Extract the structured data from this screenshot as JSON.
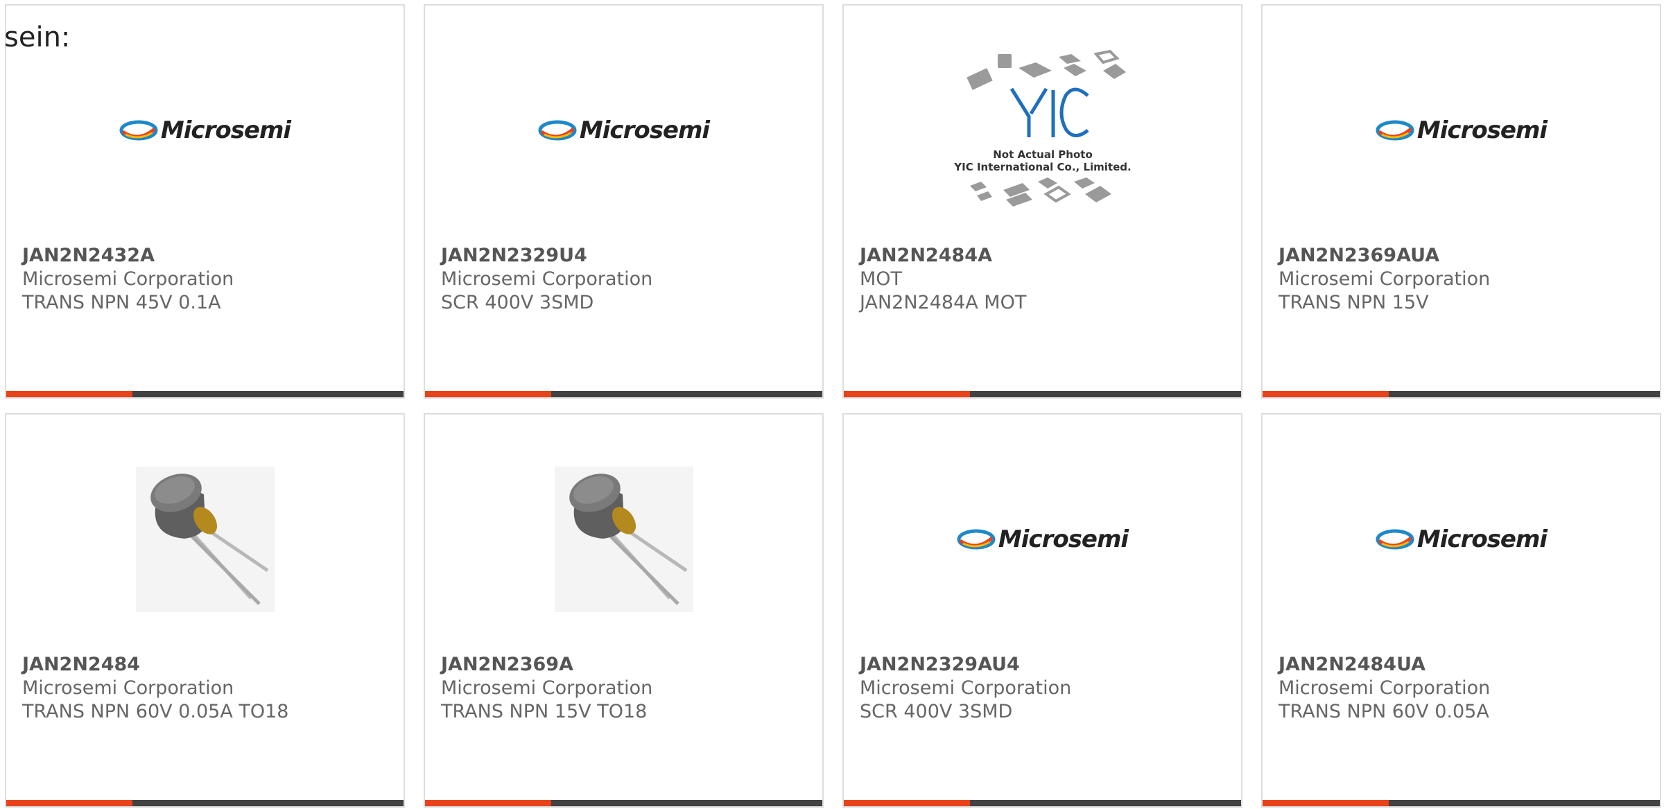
{
  "intro_text": "sein:",
  "colors": {
    "accent": "#e8431a",
    "bar": "#424242"
  },
  "products": [
    {
      "part": "JAN2N2432A",
      "maker": "Microsemi Corporation",
      "desc": "TRANS NPN 45V 0.1A",
      "image": "microsemi-logo",
      "logo_text": "Microsemi"
    },
    {
      "part": "JAN2N2329U4",
      "maker": "Microsemi Corporation",
      "desc": "SCR 400V 3SMD",
      "image": "microsemi-logo",
      "logo_text": "Microsemi"
    },
    {
      "part": "JAN2N2484A",
      "maker": "MOT",
      "desc": "JAN2N2484A MOT",
      "image": "yic-placeholder",
      "logo_text": "YIC",
      "caption_line1": "Not Actual Photo",
      "caption_line2": "YIC International Co., Limited."
    },
    {
      "part": "JAN2N2369AUA",
      "maker": "Microsemi Corporation",
      "desc": "TRANS NPN 15V",
      "image": "microsemi-logo",
      "logo_text": "Microsemi"
    },
    {
      "part": "JAN2N2484",
      "maker": "Microsemi Corporation",
      "desc": "TRANS NPN 60V 0.05A TO18",
      "image": "to18-transistor"
    },
    {
      "part": "JAN2N2369A",
      "maker": "Microsemi Corporation",
      "desc": "TRANS NPN 15V TO18",
      "image": "to18-transistor"
    },
    {
      "part": "JAN2N2329AU4",
      "maker": "Microsemi Corporation",
      "desc": "SCR 400V 3SMD",
      "image": "microsemi-logo",
      "logo_text": "Microsemi"
    },
    {
      "part": "JAN2N2484UA",
      "maker": "Microsemi Corporation",
      "desc": "TRANS NPN 60V 0.05A",
      "image": "microsemi-logo",
      "logo_text": "Microsemi"
    }
  ]
}
